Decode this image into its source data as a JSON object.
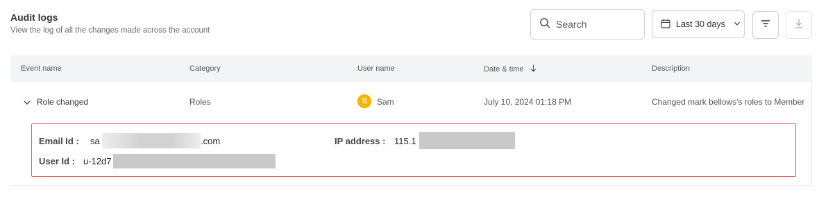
{
  "header": {
    "title": "Audit logs",
    "subtitle": "View the log of all the changes made across the account"
  },
  "toolbar": {
    "search_placeholder": "Search",
    "date_range_label": "Last 30 days"
  },
  "table": {
    "columns": [
      "Event name",
      "Category",
      "User name",
      "Date & time",
      "Description"
    ],
    "sort_column": "Date & time",
    "rows": [
      {
        "event_name": "Role changed",
        "category": "Roles",
        "user_initial": "S",
        "user_name": "Sam",
        "date_time": "July 10, 2024 01:18 PM",
        "description": "Changed mark bellows's roles to Member",
        "expanded": true,
        "details": {
          "email_label": "Email Id :",
          "email_prefix": "sa",
          "email_suffix": ".com",
          "ip_label": "IP address :",
          "ip_prefix": "115.1",
          "user_id_label": "User Id :",
          "user_id_prefix": "u-12d7"
        }
      }
    ]
  },
  "colors": {
    "highlight_border": "#e06060",
    "avatar_bg": "#f4b400",
    "header_bg": "#f3f4f6"
  }
}
